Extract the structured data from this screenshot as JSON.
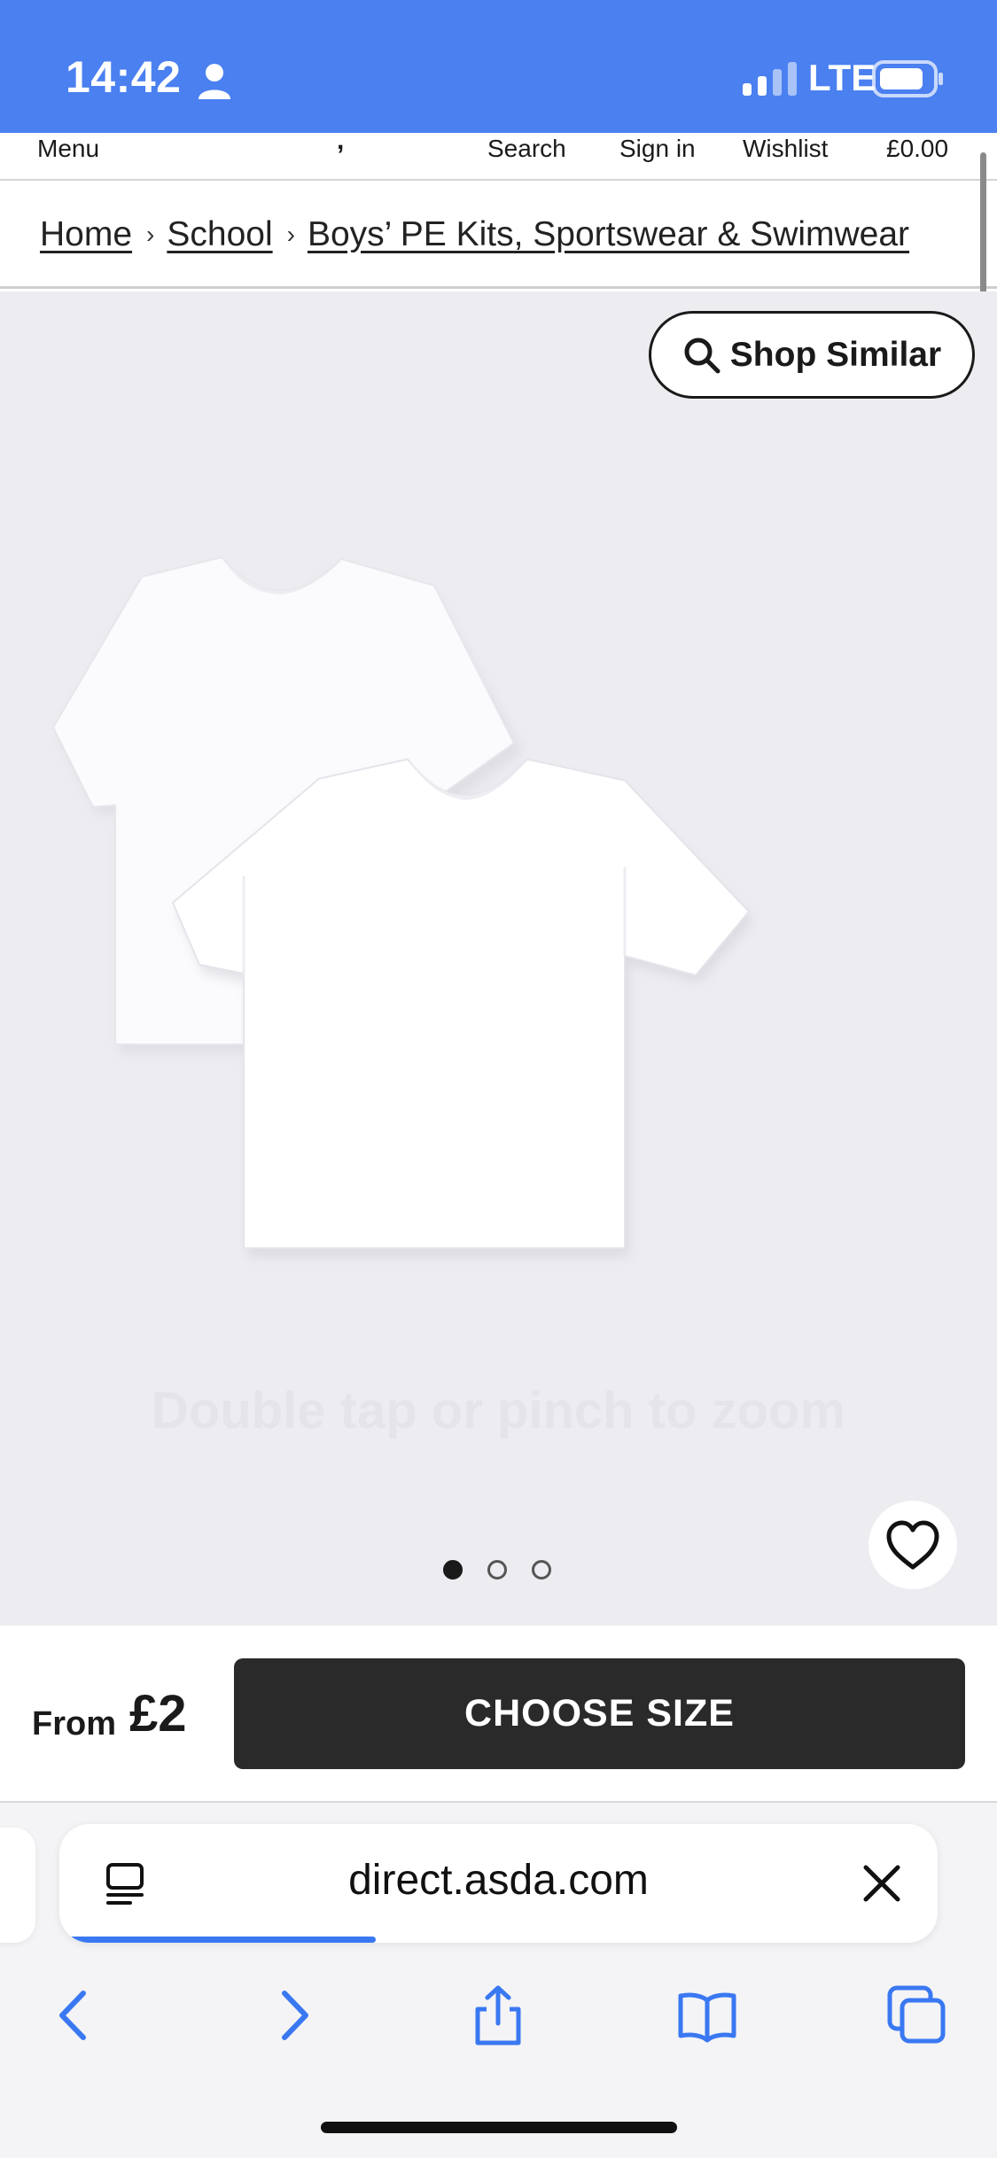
{
  "status_bar": {
    "time": "14:42",
    "network": "LTE",
    "icons": [
      "person-icon",
      "signal-icon",
      "battery-icon"
    ]
  },
  "site_header": {
    "logo_fragment": ",",
    "menu_label": "Menu",
    "search_label": "Search",
    "signin_label": "Sign in",
    "wishlist_label": "Wishlist",
    "basket_total": "£0.00"
  },
  "breadcrumb": {
    "items": [
      {
        "label": "Home"
      },
      {
        "label": "School"
      },
      {
        "label": "Boys’ PE Kits, Sportswear & Swimwear"
      }
    ]
  },
  "gallery": {
    "shop_similar_label": "Shop Similar",
    "zoom_hint": "Double tap or pinch to zoom",
    "image_count": 3,
    "active_image": 1,
    "product_image": "two white short-sleeve t-shirts",
    "favourite_icon": "heart-icon"
  },
  "purchase": {
    "from_label": "From",
    "price": "£2",
    "choose_size_label": "CHOOSE SIZE"
  },
  "browser": {
    "url": "direct.asda.com",
    "load_progress": 0.36,
    "toolbar_icons": [
      "back-icon",
      "forward-icon",
      "share-icon",
      "bookmarks-icon",
      "tabs-icon"
    ]
  },
  "colors": {
    "status_bar": "#4a80f0",
    "button_dark": "#2a2a2a",
    "gallery_bg": "#ececf1",
    "accent_blue": "#3a78f2"
  }
}
